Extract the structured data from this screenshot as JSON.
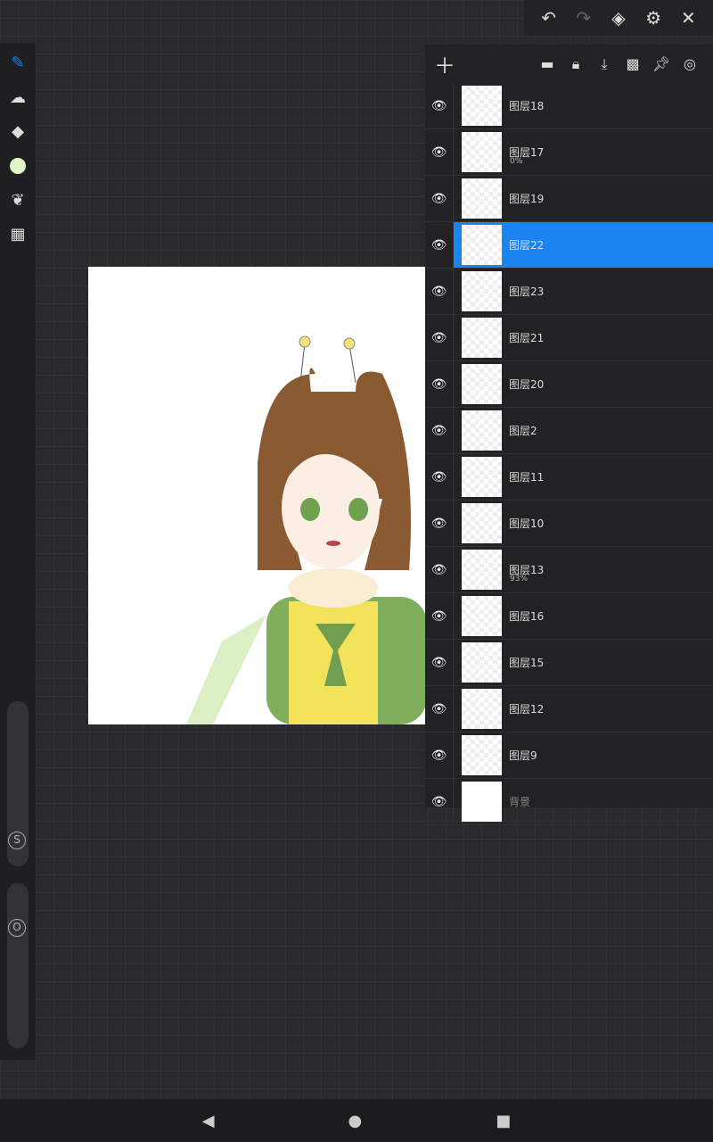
{
  "topbar": {
    "undo": "undo-icon",
    "redo": "redo-icon",
    "layers": "layers-icon",
    "settings": "gear-icon",
    "close": "close-icon"
  },
  "left_toolbar": {
    "tools": [
      "pen",
      "smudge",
      "eraser",
      "color",
      "leaf-brush",
      "grid-menu"
    ],
    "color": "#e2f5c8",
    "size_label": "S",
    "opacity_label": "O"
  },
  "layer_panel": {
    "layers": [
      {
        "name": "图层18"
      },
      {
        "name": "图层17",
        "opacity": "0%"
      },
      {
        "name": "图层19"
      },
      {
        "name": "图层22",
        "selected": true
      },
      {
        "name": "图层23"
      },
      {
        "name": "图层21"
      },
      {
        "name": "图层20"
      },
      {
        "name": "图层2"
      },
      {
        "name": "图层11"
      },
      {
        "name": "图层10"
      },
      {
        "name": "图层13",
        "opacity": "93%"
      },
      {
        "name": "图层16"
      },
      {
        "name": "图层15"
      },
      {
        "name": "图层12"
      },
      {
        "name": "图层9"
      },
      {
        "name": "背景"
      }
    ],
    "accent": "#1a84f0"
  }
}
